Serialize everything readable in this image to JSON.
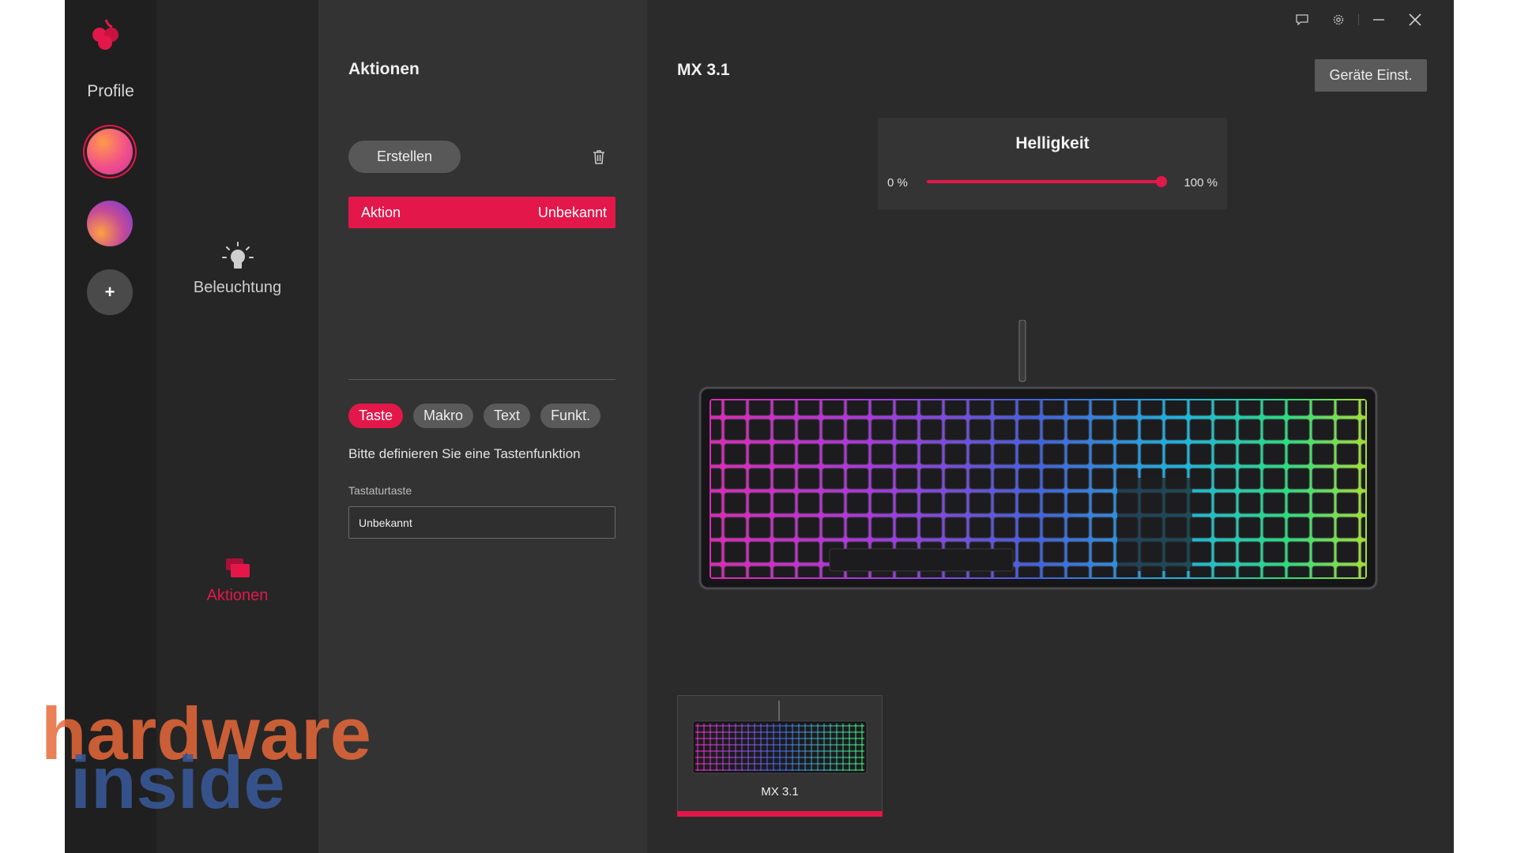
{
  "rail": {
    "title": "Profile",
    "add_label": "+"
  },
  "modes": {
    "lighting": "Beleuchtung",
    "actions": "Aktionen"
  },
  "actions_panel": {
    "title": "Aktionen",
    "create_label": "Erstellen",
    "action_row": {
      "name": "Aktion",
      "value": "Unbekannt"
    },
    "pills": [
      {
        "label": "Taste",
        "active": true
      },
      {
        "label": "Makro",
        "active": false
      },
      {
        "label": "Text",
        "active": false
      },
      {
        "label": "Funkt.",
        "active": false
      }
    ],
    "hint": "Bitte definieren Sie eine Tastenfunktion",
    "field_label": "Tastaturtaste",
    "field_value": "Unbekannt"
  },
  "device": {
    "title": "MX 3.1",
    "settings_label": "Geräte Einst.",
    "brightness": {
      "title": "Helligkeit",
      "min_label": "0 %",
      "max_label": "100 %",
      "value_percent": 100
    },
    "card_name": "MX 3.1"
  },
  "watermark": {
    "line1": "hardware",
    "line2": "inside"
  },
  "colors": {
    "accent": "#e4174a",
    "background": "#2b2b2b",
    "rail": "#1f1f1f"
  },
  "icons": {
    "lighting": "lightbulb-icon",
    "actions": "stacked-windows-icon",
    "delete": "trash-icon",
    "feedback": "chat-bubble-icon",
    "settings": "gear-icon",
    "minimize": "minimize-icon",
    "close": "close-icon"
  }
}
